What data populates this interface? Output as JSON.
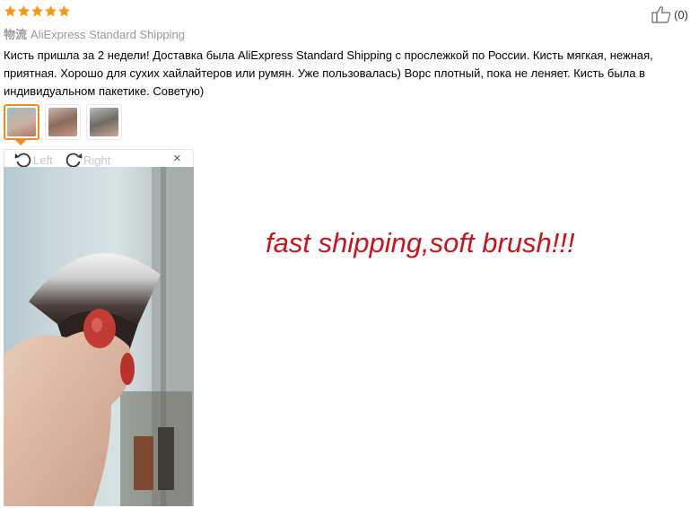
{
  "rating": {
    "stars": 5,
    "max": 5,
    "star_color": "#f49a0b",
    "icon": "star-icon"
  },
  "helpful": {
    "icon": "thumbs-up-icon",
    "count": "(0)"
  },
  "logistics": {
    "label": "物流",
    "value": "AliExpress Standard Shipping"
  },
  "review": {
    "text": "Кисть пришла за 2 недели! Доставка была AliExpress Standard Shipping с прослежкой по России. Кисть мягкая, нежная, приятная. Хорошо для сухих хайлайтеров или румян. Уже пользовалась) Ворс плотный, пока не леняет. Кисть была в индивидуальном пакетике. Советую)"
  },
  "gallery": {
    "selected_index": 0,
    "thumbnails": [
      "thumb-1",
      "thumb-2",
      "thumb-3"
    ],
    "accent": "#f28b1b"
  },
  "viewer": {
    "rotate_left_label": "Left",
    "rotate_right_label": "Right",
    "close_glyph": "×"
  },
  "promo": {
    "text": "fast shipping,soft brush!!!",
    "color": "#c8141e"
  }
}
